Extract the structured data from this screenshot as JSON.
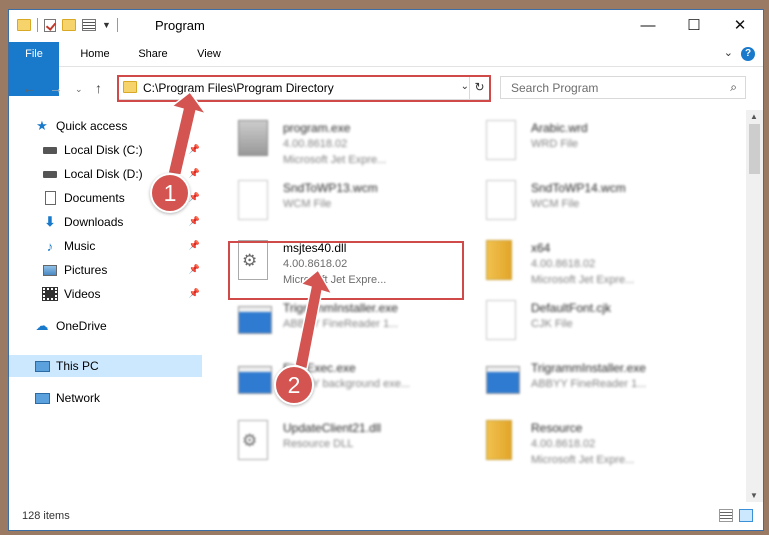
{
  "window": {
    "title": "Program",
    "minimize_glyph": "—",
    "maximize_glyph": "☐",
    "close_glyph": "✕"
  },
  "ribbon": {
    "tabs": [
      "File",
      "Home",
      "Share",
      "View"
    ],
    "help_glyph": "?"
  },
  "address_bar": {
    "path": "C:\\Program Files\\Program Directory",
    "refresh_glyph": "↻"
  },
  "search": {
    "placeholder": "Search Program"
  },
  "sidebar": {
    "items": [
      {
        "label": "Quick access",
        "icon": "star-icon"
      },
      {
        "label": "Local Disk (C:)",
        "icon": "disk-icon",
        "pinned": true
      },
      {
        "label": "Local Disk (D:)",
        "icon": "disk-icon",
        "pinned": true
      },
      {
        "label": "Documents",
        "icon": "documents-icon",
        "pinned": true
      },
      {
        "label": "Downloads",
        "icon": "download-icon",
        "pinned": true
      },
      {
        "label": "Music",
        "icon": "music-icon",
        "pinned": true
      },
      {
        "label": "Pictures",
        "icon": "pictures-icon",
        "pinned": true
      },
      {
        "label": "Videos",
        "icon": "videos-icon",
        "pinned": true
      },
      {
        "label": "OneDrive",
        "icon": "cloud-icon"
      },
      {
        "label": "This PC",
        "icon": "computer-icon",
        "selected": true
      },
      {
        "label": "Network",
        "icon": "network-icon"
      }
    ]
  },
  "files": [
    {
      "name": "program.exe",
      "line2": "4.00.8618.02",
      "line3": "Microsoft Jet Expre...",
      "icon": "setup-icon"
    },
    {
      "name": "Arabic.wrd",
      "line2": "WRD File",
      "line3": "",
      "icon": "page-icon"
    },
    {
      "name": "SndToWP13.wcm",
      "line2": "WCM File",
      "line3": "",
      "icon": "page-icon"
    },
    {
      "name": "SndToWP14.wcm",
      "line2": "WCM File",
      "line3": "",
      "icon": "page-icon"
    },
    {
      "name": "msjtes40.dll",
      "line2": "4.00.8618.02",
      "line3": "Microsoft Jet Expre...",
      "icon": "dll-icon"
    },
    {
      "name": "x64",
      "line2": "4.00.8618.02",
      "line3": "Microsoft Jet Expre...",
      "icon": "folder-icon"
    },
    {
      "name": "TrigrammInstaller.exe",
      "line2": "ABBYY FineReader 1...",
      "line3": "",
      "icon": "exe-icon"
    },
    {
      "name": "DefaultFont.cjk",
      "line2": "CJK File",
      "line3": "",
      "icon": "page-icon"
    },
    {
      "name": "FineExec.exe",
      "line2": "ABBYY background exe...",
      "line3": "",
      "icon": "exe-icon"
    },
    {
      "name": "TrigrammInstaller.exe",
      "line2": "ABBYY FineReader 1...",
      "line3": "",
      "icon": "exe-icon"
    },
    {
      "name": "UpdateClient21.dll",
      "line2": "Resource DLL",
      "line3": "",
      "icon": "dll-icon"
    },
    {
      "name": "Resource",
      "line2": "4.00.8618.02",
      "line3": "Microsoft Jet Expre...",
      "icon": "folder-icon"
    }
  ],
  "status": {
    "item_count": "128 items"
  },
  "annotations": {
    "badge1": "1",
    "badge2": "2"
  },
  "colors": {
    "accent": "#1979ca",
    "highlight": "#d04a4a",
    "selected": "#cce8ff"
  }
}
